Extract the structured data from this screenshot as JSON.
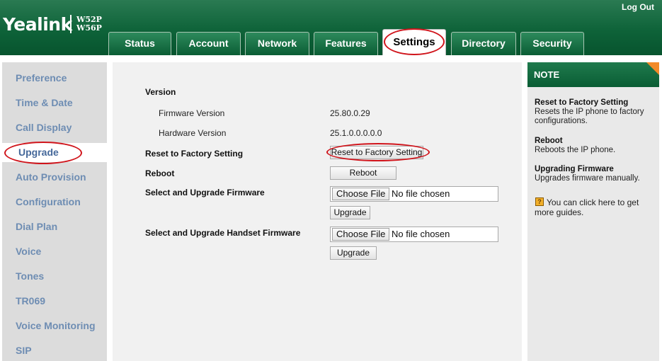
{
  "header": {
    "brand": "Yealink",
    "models": [
      "W52P",
      "W56P"
    ],
    "logout_label": "Log Out"
  },
  "tabs": [
    {
      "label": "Status"
    },
    {
      "label": "Account"
    },
    {
      "label": "Network"
    },
    {
      "label": "Features"
    },
    {
      "label": "Settings",
      "active": true
    },
    {
      "label": "Directory"
    },
    {
      "label": "Security"
    }
  ],
  "sidebar": {
    "items": [
      {
        "label": "Preference"
      },
      {
        "label": "Time & Date"
      },
      {
        "label": "Call Display"
      },
      {
        "label": "Upgrade",
        "active": true
      },
      {
        "label": "Auto Provision"
      },
      {
        "label": "Configuration"
      },
      {
        "label": "Dial Plan"
      },
      {
        "label": "Voice"
      },
      {
        "label": "Tones"
      },
      {
        "label": "TR069"
      },
      {
        "label": "Voice Monitoring"
      },
      {
        "label": "SIP"
      }
    ]
  },
  "main": {
    "version_heading": "Version",
    "firmware_label": "Firmware Version",
    "firmware_value": "25.80.0.29",
    "hardware_label": "Hardware Version",
    "hardware_value": "25.1.0.0.0.0.0",
    "reset_label": "Reset to Factory Setting",
    "reset_button": "Reset to Factory Setting",
    "reboot_label": "Reboot",
    "reboot_button": "Reboot",
    "firmware_upgrade_label": "Select and Upgrade Firmware",
    "handset_upgrade_label": "Select and Upgrade Handset Firmware",
    "choose_file": "Choose File",
    "no_file": "No file chosen",
    "upgrade_button": "Upgrade"
  },
  "note": {
    "title": "NOTE",
    "reset_title": "Reset to Factory Setting",
    "reset_desc_1": "Resets the IP phone to factory",
    "reset_desc_2": "configurations.",
    "reboot_title": "Reboot",
    "reboot_desc": "Reboots the IP phone.",
    "upgrade_title": "Upgrading Firmware",
    "upgrade_desc": "Upgrades firmware manually.",
    "guide_1": "You can click here to get",
    "guide_2": "more guides."
  },
  "colors": {
    "header_green": "#0e6339",
    "highlight_red": "#d0141b",
    "nav_text": "#6e8db3",
    "note_fold": "#f28a28"
  }
}
